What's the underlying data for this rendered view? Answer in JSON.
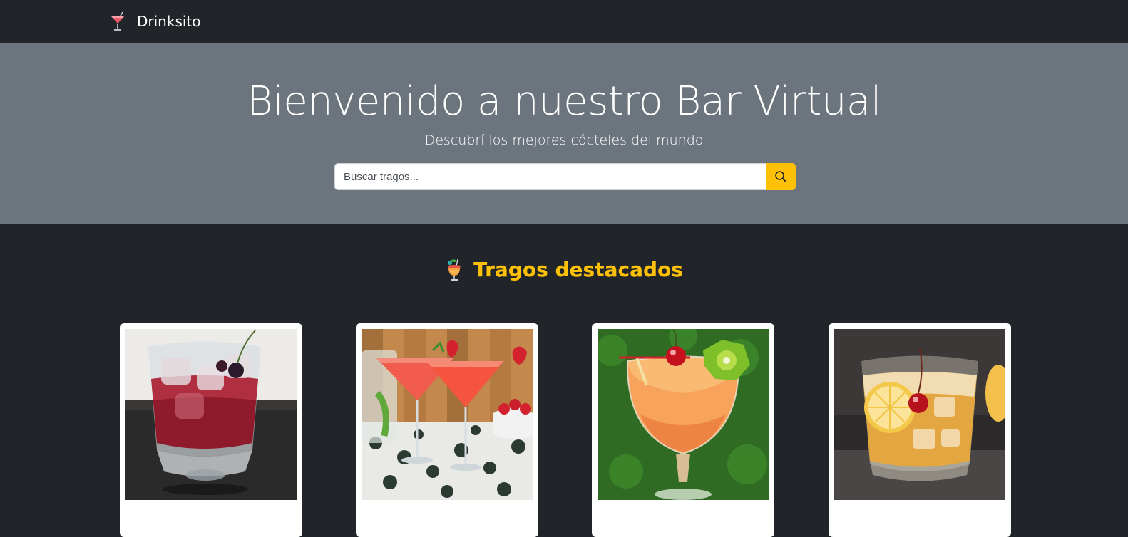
{
  "navbar": {
    "brand_name": "Drinksito",
    "logo_icon": "cocktail-glass-icon"
  },
  "hero": {
    "title": "Bienvenido a nuestro Bar Virtual",
    "subtitle": "Descubrí los mejores cócteles del mundo",
    "search": {
      "placeholder": "Buscar tragos...",
      "value": "",
      "button_icon": "search-icon"
    }
  },
  "featured": {
    "icon": "tropical-drink-icon",
    "title": "Tragos destacados",
    "cards": [
      {
        "image": "red-drink-on-rocks-with-cherry"
      },
      {
        "image": "two-strawberry-martinis"
      },
      {
        "image": "orange-cocktail-with-cherry-and-kiwi"
      },
      {
        "image": "whiskey-sour-with-lemon-and-cherry"
      }
    ]
  },
  "colors": {
    "navbar_bg": "#212529",
    "hero_bg": "#6c757d",
    "accent": "#ffc107",
    "page_bg": "#212529"
  }
}
